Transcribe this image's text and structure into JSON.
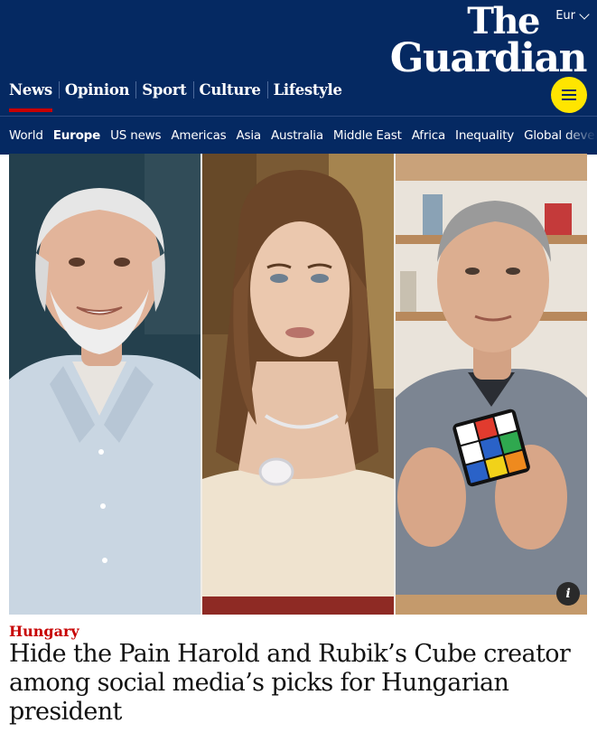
{
  "header": {
    "edition_label": "Eur",
    "logo_line1": "The",
    "logo_line2": "Guardian",
    "pillars": [
      {
        "label": "News",
        "active": true
      },
      {
        "label": "Opinion"
      },
      {
        "label": "Sport"
      },
      {
        "label": "Culture"
      },
      {
        "label": "Lifestyle"
      }
    ],
    "menu_icon": "hamburger-menu-icon"
  },
  "subnav": {
    "items": [
      "World",
      "Europe",
      "US news",
      "Americas",
      "Asia",
      "Australia",
      "Middle East",
      "Africa",
      "Inequality",
      "Global development"
    ],
    "active": "Europe"
  },
  "image": {
    "info_icon_label": "i"
  },
  "article": {
    "kicker": "Hungary",
    "headline": "Hide the Pain Harold and Rubik’s Cube creator among social media’s picks for Hungarian president"
  },
  "colors": {
    "brand_blue": "#052962",
    "news_red": "#c70000",
    "menu_yellow": "#ffe500"
  }
}
